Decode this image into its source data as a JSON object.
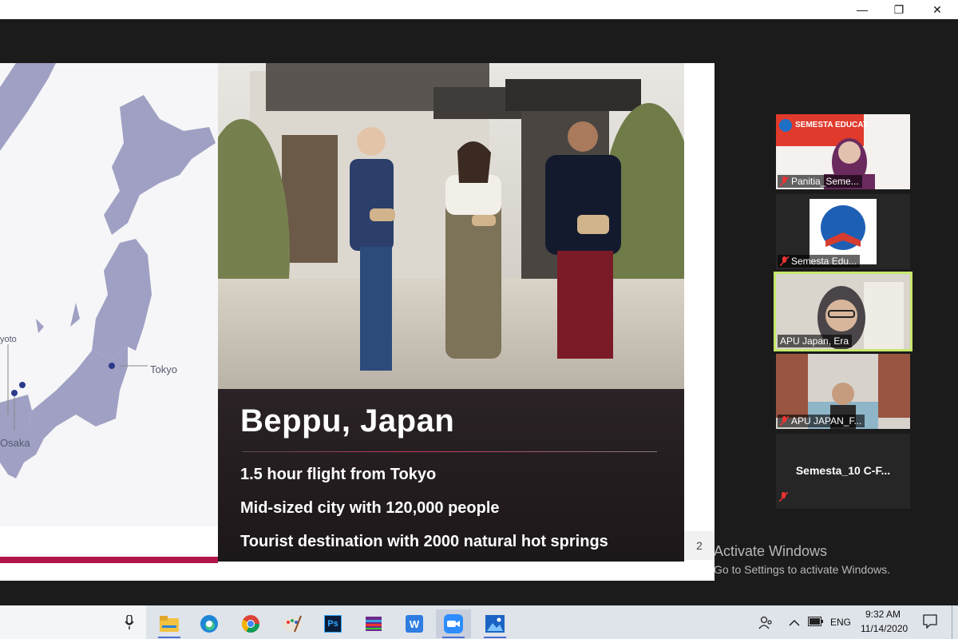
{
  "window": {
    "minimize_glyph": "—",
    "restore_glyph": "❐",
    "close_glyph": "✕"
  },
  "slide": {
    "map_labels": {
      "kyoto": "yoto",
      "osaka": "Osaka",
      "tokyo": "Tokyo"
    },
    "title": "Beppu, Japan",
    "bullets": [
      "1.5 hour flight from Tokyo",
      "Mid-sized city with 120,000 people",
      "Tourist destination with 2000 natural hot springs"
    ],
    "page_number": "2"
  },
  "watermark": {
    "line1": "Activate Windows",
    "line2": "Go to Settings to activate Windows."
  },
  "participants": [
    {
      "name": "Panitia_Seme...",
      "muted": true,
      "active_speaker": false,
      "banner_text": "SEMESTA EDUCAT"
    },
    {
      "name": "Semesta Edu...",
      "muted": true,
      "active_speaker": false
    },
    {
      "name": "APU Japan, Era",
      "muted": false,
      "active_speaker": true
    },
    {
      "name": "APU JAPAN_F...",
      "muted": true,
      "active_speaker": false
    },
    {
      "name": "Semesta_10  C-F...",
      "muted": true,
      "active_speaker": false,
      "video_off": true
    }
  ],
  "taskbar": {
    "apps": [
      "file-explorer-icon",
      "edge-icon",
      "chrome-icon",
      "paint-icon",
      "photoshop-icon",
      "winrar-icon",
      "wps-writer-icon",
      "zoom-icon",
      "photos-icon"
    ],
    "photoshop_label": "Ps",
    "wps_label": "W",
    "language": "ENG",
    "time": "9:32 AM",
    "date": "11/14/2020"
  },
  "colors": {
    "accent": "#b0154a",
    "active_speaker": "#c7e86a",
    "map_land": "#9fa0c3",
    "map_dot": "#2b3a8a"
  }
}
